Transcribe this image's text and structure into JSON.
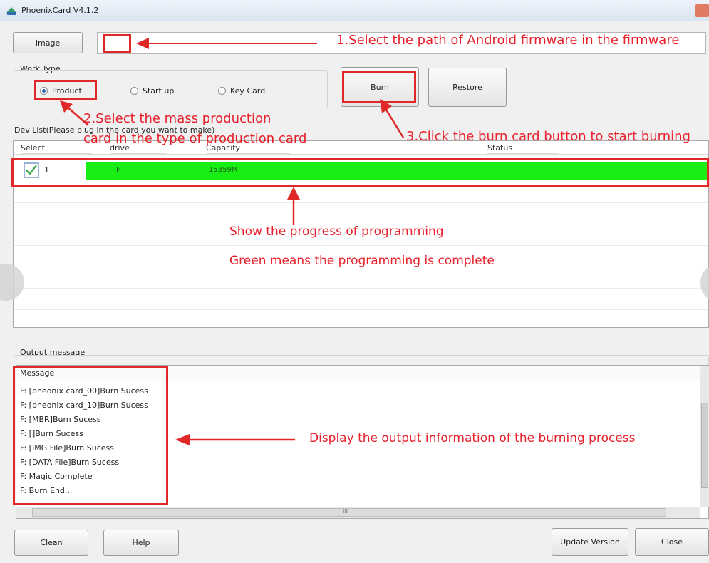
{
  "window": {
    "title": "PhoenixCard V4.1.2"
  },
  "buttons": {
    "image": "Image",
    "burn": "Burn",
    "restore": "Restore",
    "clean": "Clean",
    "help": "Help",
    "update": "Update Version",
    "close": "Close"
  },
  "work_type": {
    "label": "Work Type",
    "options": [
      "Product",
      "Start up",
      "Key Card"
    ],
    "selected": "Product"
  },
  "dev_list": {
    "label": "Dev List(Please plug in the card you want to make)",
    "columns": [
      "Select",
      "drive",
      "Capacity",
      "Status"
    ],
    "rows": [
      {
        "checked": true,
        "index": "1",
        "drive": "F",
        "capacity": "15359M",
        "status_color": "#19ee14"
      }
    ]
  },
  "output": {
    "label": "Output message",
    "header": "Message",
    "lines": [
      "F: [pheonix card_00]Burn Sucess",
      "F: [pheonix card_10]Burn Sucess",
      "F: [MBR]Burn Sucess",
      "F: []Burn Sucess",
      "F: [IMG File]Burn Sucess",
      "F: [DATA File]Burn Sucess",
      "F: Magic Complete",
      "F: Burn End..."
    ],
    "scroll_mark": "III"
  },
  "annotations": {
    "step1": "1.Select the path of Android firmware in the firmware",
    "step2_line1": "2.Select the mass production",
    "step2_line2": "card in the type of production card",
    "step3": "3.Click the burn card button to start burning",
    "progress1": "Show the progress of programming",
    "progress2": "Green means the programming is complete",
    "output": "Display the output information of the burning process"
  },
  "colors": {
    "annotation": "#e8202b",
    "progress": "#19ee14",
    "accent": "#2d62b4"
  }
}
